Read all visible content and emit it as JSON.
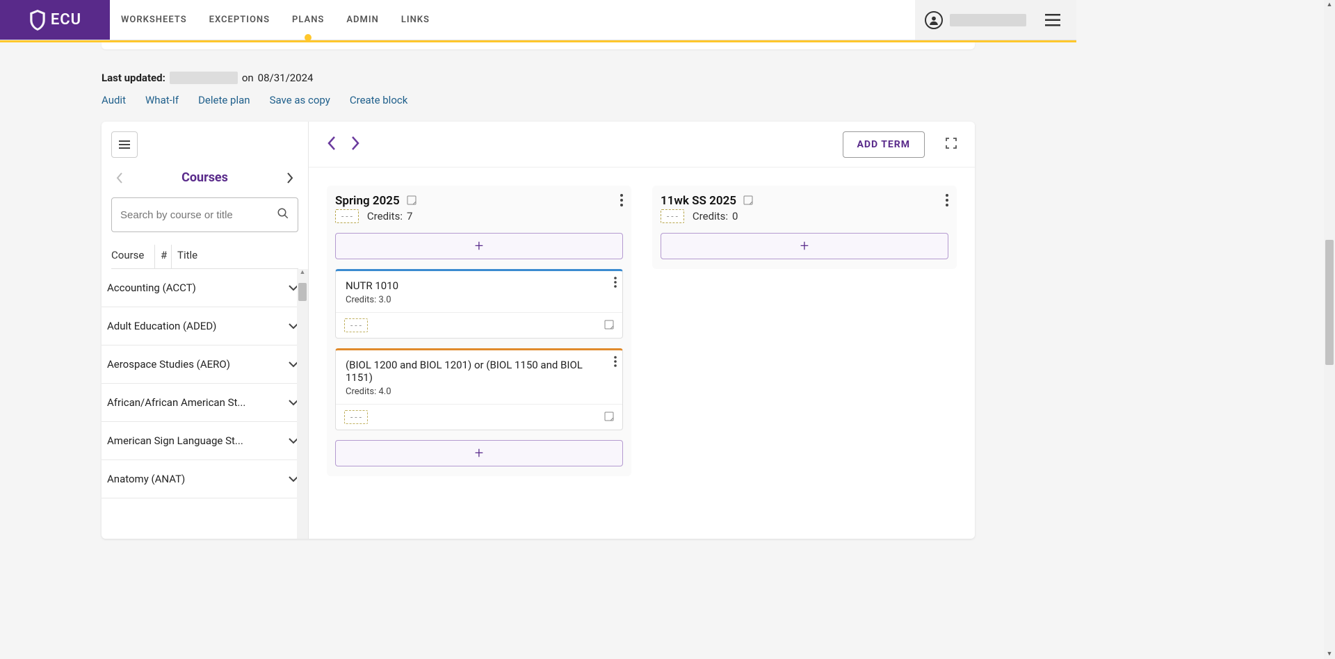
{
  "brand": {
    "name": "ECU"
  },
  "nav": {
    "items": [
      {
        "label": "WORKSHEETS",
        "active": false
      },
      {
        "label": "EXCEPTIONS",
        "active": false
      },
      {
        "label": "PLANS",
        "active": true
      },
      {
        "label": "ADMIN",
        "active": false
      },
      {
        "label": "LINKS",
        "active": false
      }
    ]
  },
  "meta": {
    "last_updated_label": "Last updated:",
    "on_text": "on",
    "date": "08/31/2024"
  },
  "actions": {
    "audit": "Audit",
    "whatif": "What-If",
    "delete_plan": "Delete plan",
    "save_as_copy": "Save as copy",
    "create_block": "Create block"
  },
  "sidebar": {
    "title": "Courses",
    "search_placeholder": "Search by course or title",
    "columns": {
      "course": "Course",
      "num": "#",
      "title": "Title"
    },
    "subjects": [
      "Accounting (ACCT)",
      "Adult Education (ADED)",
      "Aerospace Studies (AERO)",
      "African/African American St...",
      "American Sign Language St...",
      "Anatomy (ANAT)"
    ]
  },
  "toolbar": {
    "add_term": "ADD TERM"
  },
  "terms": [
    {
      "title": "Spring 2025",
      "credits_label": "Credits:",
      "credits": "7",
      "status": "- - -",
      "cards": [
        {
          "accent": "blue",
          "title": "NUTR 1010",
          "credits": "Credits: 3.0",
          "status": "- - -"
        },
        {
          "accent": "orange",
          "title": "(BIOL 1200 and BIOL 1201) or (BIOL 1150 and BIOL 1151)",
          "credits": "Credits: 4.0",
          "status": "- - -"
        }
      ]
    },
    {
      "title": "11wk SS 2025",
      "credits_label": "Credits:",
      "credits": "0",
      "status": "- - -",
      "cards": []
    }
  ]
}
